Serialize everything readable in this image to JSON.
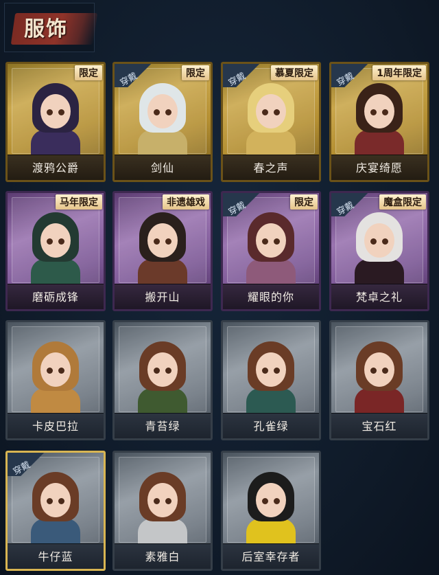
{
  "header": {
    "title": "服饰"
  },
  "cards": [
    {
      "name": "渡鸦公爵",
      "tag": "限定",
      "worn": false,
      "frame": "gold",
      "hair": "#2b2342",
      "body": "#3a2d5c"
    },
    {
      "name": "剑仙",
      "tag": "限定",
      "worn": true,
      "worn_label": "穿戴",
      "frame": "gold",
      "hair": "#dfe6e8",
      "body": "#c7b06a"
    },
    {
      "name": "春之声",
      "tag": "慕夏限定",
      "worn": true,
      "worn_label": "穿戴",
      "frame": "gold",
      "hair": "#e6cf7c",
      "body": "#d2b25c"
    },
    {
      "name": "庆宴绮愿",
      "tag": "1周年限定",
      "worn": true,
      "worn_label": "穿戴",
      "frame": "gold",
      "hair": "#3a2218",
      "body": "#7a2a2a"
    },
    {
      "name": "磨砺成锋",
      "tag": "马年限定",
      "worn": false,
      "frame": "purple",
      "hair": "#233a32",
      "body": "#2d5a4a"
    },
    {
      "name": "搬开山",
      "tag": "非遗雄戏",
      "worn": false,
      "frame": "purple",
      "hair": "#2a201c",
      "body": "#6b3a2a"
    },
    {
      "name": "耀眼的你",
      "tag": "限定",
      "worn": true,
      "worn_label": "穿戴",
      "frame": "purple",
      "hair": "#5a2a2c",
      "body": "#8e5a7a"
    },
    {
      "name": "梵卓之礼",
      "tag": "魔盒限定",
      "worn": true,
      "worn_label": "穿戴",
      "frame": "purple",
      "hair": "#e4e2e0",
      "body": "#2a1a22"
    },
    {
      "name": "卡皮巴拉",
      "tag": "",
      "worn": false,
      "frame": "grey",
      "hair": "#b07a3a",
      "body": "#c08a42"
    },
    {
      "name": "青苔绿",
      "tag": "",
      "worn": false,
      "frame": "grey",
      "hair": "#6a3c26",
      "body": "#3f5a30"
    },
    {
      "name": "孔雀绿",
      "tag": "",
      "worn": false,
      "frame": "grey",
      "hair": "#6a3c26",
      "body": "#2c5a52"
    },
    {
      "name": "宝石红",
      "tag": "",
      "worn": false,
      "frame": "grey",
      "hair": "#6a3c26",
      "body": "#7a2626"
    },
    {
      "name": "牛仔蓝",
      "tag": "",
      "worn": true,
      "worn_label": "穿戴",
      "frame": "grey",
      "equipped": true,
      "hair": "#6a3c26",
      "body": "#3a5a7a"
    },
    {
      "name": "素雅白",
      "tag": "",
      "worn": false,
      "frame": "grey",
      "hair": "#6a3c26",
      "body": "#c4c6c8"
    },
    {
      "name": "后室幸存者",
      "tag": "",
      "worn": false,
      "frame": "grey",
      "hair": "#1c1c1c",
      "body": "#e0c21e"
    }
  ]
}
